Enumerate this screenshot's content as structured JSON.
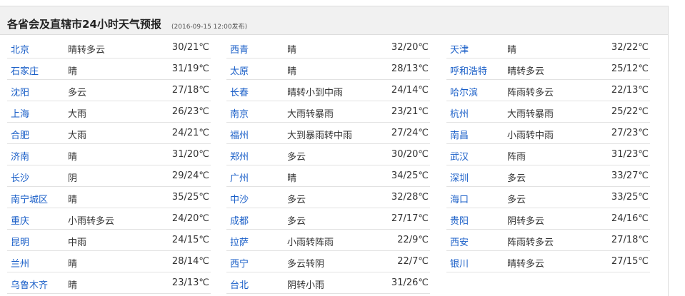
{
  "header": {
    "title": "各省会及直辖市24小时天气预报",
    "time": "(2016-09-15 12:00发布)"
  },
  "rows": [
    [
      {
        "city": "北京",
        "weather": "晴转多云",
        "temp": "30/21℃"
      },
      {
        "city": "西青",
        "weather": "晴",
        "temp": "32/20℃"
      },
      {
        "city": "天津",
        "weather": "晴",
        "temp": "32/22℃"
      }
    ],
    [
      {
        "city": "石家庄",
        "weather": "晴",
        "temp": "31/19℃"
      },
      {
        "city": "太原",
        "weather": "晴",
        "temp": "28/13℃"
      },
      {
        "city": "呼和浩特",
        "weather": "晴转多云",
        "temp": "25/12℃"
      }
    ],
    [
      {
        "city": "沈阳",
        "weather": "多云",
        "temp": "27/18℃"
      },
      {
        "city": "长春",
        "weather": "晴转小到中雨",
        "temp": "24/14℃"
      },
      {
        "city": "哈尔滨",
        "weather": "阵雨转多云",
        "temp": "22/13℃"
      }
    ],
    [
      {
        "city": "上海",
        "weather": "大雨",
        "temp": "26/23℃"
      },
      {
        "city": "南京",
        "weather": "大雨转暴雨",
        "temp": "23/21℃"
      },
      {
        "city": "杭州",
        "weather": "大雨转暴雨",
        "temp": "25/22℃"
      }
    ],
    [
      {
        "city": "合肥",
        "weather": "大雨",
        "temp": "24/21℃"
      },
      {
        "city": "福州",
        "weather": "大到暴雨转中雨",
        "temp": "27/24℃"
      },
      {
        "city": "南昌",
        "weather": "小雨转中雨",
        "temp": "27/23℃"
      }
    ],
    [
      {
        "city": "济南",
        "weather": "晴",
        "temp": "31/20℃"
      },
      {
        "city": "郑州",
        "weather": "多云",
        "temp": "30/20℃"
      },
      {
        "city": "武汉",
        "weather": "阵雨",
        "temp": "31/23℃"
      }
    ],
    [
      {
        "city": "长沙",
        "weather": "阴",
        "temp": "29/24℃"
      },
      {
        "city": "广州",
        "weather": "晴",
        "temp": "34/25℃"
      },
      {
        "city": "深圳",
        "weather": "多云",
        "temp": "33/27℃"
      }
    ],
    [
      {
        "city": "南宁城区",
        "weather": "晴",
        "temp": "35/25℃"
      },
      {
        "city": "中沙",
        "weather": "多云",
        "temp": "32/28℃"
      },
      {
        "city": "海口",
        "weather": "多云",
        "temp": "33/25℃"
      }
    ],
    [
      {
        "city": "重庆",
        "weather": "小雨转多云",
        "temp": "24/20℃"
      },
      {
        "city": "成都",
        "weather": "多云",
        "temp": "27/17℃"
      },
      {
        "city": "贵阳",
        "weather": "阴转多云",
        "temp": "24/16℃"
      }
    ],
    [
      {
        "city": "昆明",
        "weather": "中雨",
        "temp": "24/15℃"
      },
      {
        "city": "拉萨",
        "weather": "小雨转阵雨",
        "temp": "22/9℃"
      },
      {
        "city": "西安",
        "weather": "阵雨转多云",
        "temp": "27/18℃"
      }
    ],
    [
      {
        "city": "兰州",
        "weather": "晴",
        "temp": "28/14℃"
      },
      {
        "city": "西宁",
        "weather": "多云转阴",
        "temp": "22/7℃"
      },
      {
        "city": "银川",
        "weather": "晴转多云",
        "temp": "27/15℃"
      }
    ],
    [
      {
        "city": "乌鲁木齐",
        "weather": "晴",
        "temp": "23/13℃"
      },
      {
        "city": "台北",
        "weather": "阴转小雨",
        "temp": "31/26℃"
      }
    ]
  ]
}
